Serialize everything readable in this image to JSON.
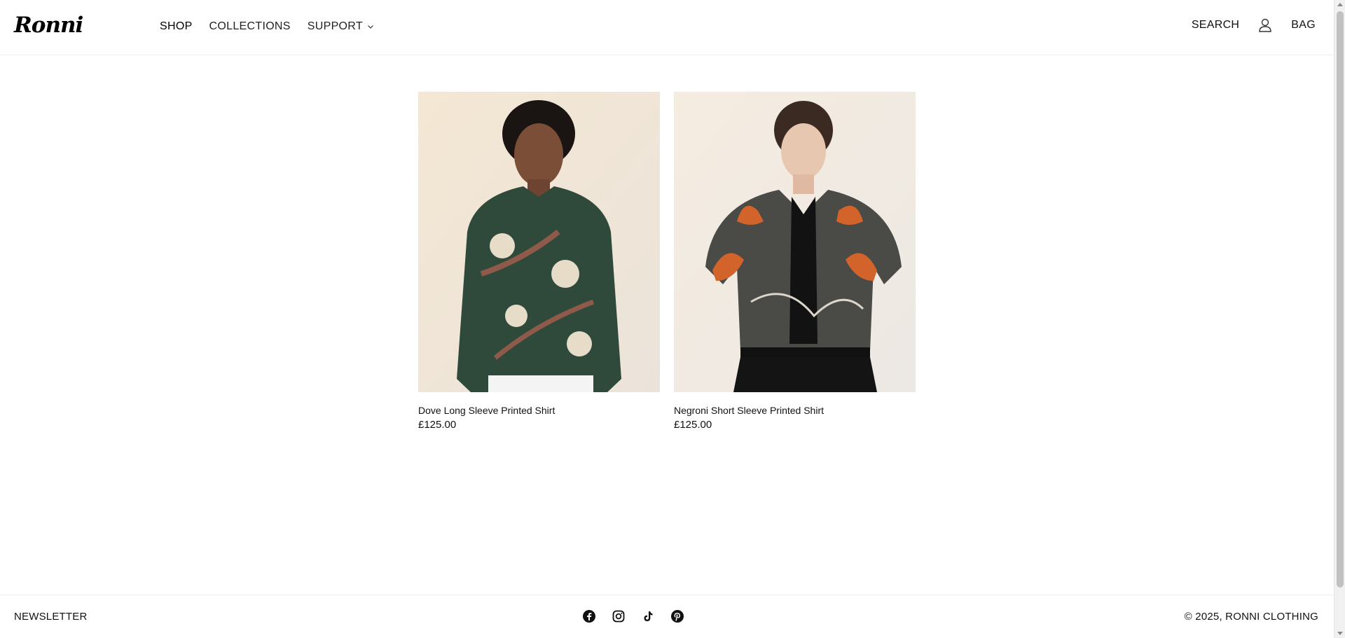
{
  "header": {
    "logo": "Ronni",
    "nav": [
      {
        "label": "SHOP"
      },
      {
        "label": "COLLECTIONS"
      },
      {
        "label": "SUPPORT"
      }
    ],
    "search_label": "SEARCH",
    "account_icon": "user-icon",
    "bag_label": "BAG"
  },
  "products": [
    {
      "title": "Dove Long Sleeve Printed Shirt",
      "price": "£125.00"
    },
    {
      "title": "Negroni Short Sleeve Printed Shirt",
      "price": "£125.00"
    }
  ],
  "footer": {
    "newsletter_label": "NEWSLETTER",
    "socials": [
      "facebook-icon",
      "instagram-icon",
      "tiktok-icon",
      "pinterest-icon"
    ],
    "copyright": "© 2025, RONNI CLOTHING"
  },
  "colors": {
    "background": "#ffffff",
    "text": "#111111",
    "shirt1": "#2f4a3b",
    "shirt2": "#4a4a47",
    "photo_bg": "#efe4d6"
  }
}
